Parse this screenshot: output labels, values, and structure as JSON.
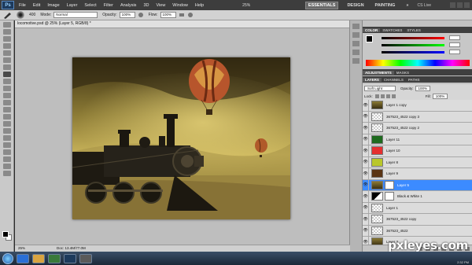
{
  "app": {
    "logo": "Ps",
    "menu": [
      "File",
      "Edit",
      "Image",
      "Layer",
      "Select",
      "Filter",
      "Analysis",
      "3D",
      "View",
      "Window",
      "Help"
    ],
    "zoom_readout": "25%",
    "workspaces": [
      "ESSENTIALS",
      "DESIGN",
      "PAINTING",
      "»"
    ],
    "cslive": "CS Live"
  },
  "options_bar": {
    "brush_size": "400",
    "mode_label": "Mode:",
    "mode_value": "Normal",
    "opacity_label": "Opacity:",
    "opacity_value": "100%",
    "flow_label": "Flow:",
    "flow_value": "100%"
  },
  "document": {
    "tab_title": "locomotive.psd @ 25% (Layer 5, RGB/8) *",
    "zoom": "25%",
    "doc_size": "Doc: 13.4M/77.0M"
  },
  "panels": {
    "color_tabs": [
      "COLOR",
      "SWATCHES",
      "STYLES"
    ],
    "adjust_tabs": [
      "ADJUSTMENTS",
      "MASKS"
    ],
    "layers_tabs": [
      "LAYERS",
      "CHANNELS",
      "PATHS"
    ],
    "blend_mode": "Soft Light",
    "opacity_label": "Opacity:",
    "opacity_value": "100%",
    "lock_label": "Lock:",
    "fill_label": "Fill:",
    "fill_value": "100%"
  },
  "layers": [
    {
      "name": "Layer 1 copy",
      "thumb": "image"
    },
    {
      "name": "367523_4522 copy 3",
      "thumb": "checker"
    },
    {
      "name": "367523_4522 copy 2",
      "thumb": "checker"
    },
    {
      "name": "Layer 11",
      "thumb": "#1e6b1e"
    },
    {
      "name": "Layer 10",
      "thumb": "#e53030"
    },
    {
      "name": "Layer 8",
      "thumb": "#b9c72a"
    },
    {
      "name": "Layer 9",
      "thumb": "#5a3515"
    },
    {
      "name": "Layer 5",
      "thumb": "image",
      "selected": true
    },
    {
      "name": "Black & White 1",
      "thumb": "adjust"
    },
    {
      "name": "Layer 1",
      "thumb": "checker"
    },
    {
      "name": "367523_4522 copy",
      "thumb": "checker"
    },
    {
      "name": "367523_4522",
      "thumb": "checker"
    },
    {
      "name": "Layer 3",
      "thumb": "image"
    }
  ],
  "watermark": "pxleyes.com",
  "clock": "2:32 PM"
}
